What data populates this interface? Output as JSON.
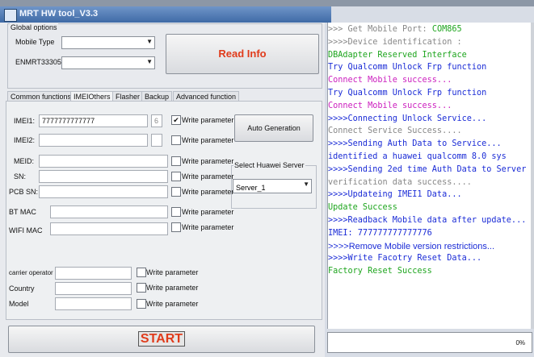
{
  "window": {
    "title": "MRT HW tool_V3.3"
  },
  "global_options": {
    "group_label": "Global options",
    "mobile_type_label": "Mobile Type",
    "mobile_type_value": "",
    "enmrt_label": "ENMRT33305",
    "enmrt_value": "",
    "read_info_label": "Read Info"
  },
  "tabs": [
    {
      "label": "Common functions",
      "active": false
    },
    {
      "label": "IMEIOthers",
      "active": true
    },
    {
      "label": "Flasher",
      "active": false
    },
    {
      "label": "Backup",
      "active": false
    },
    {
      "label": "Advanced function",
      "active": false
    }
  ],
  "imei_panel": {
    "imei1_label": "IMEI1:",
    "imei1_value": "7777777777777",
    "imei1_check_digit": "6",
    "imei2_label": "IMEI2:",
    "imei2_value": "",
    "meid_label": "MEID:",
    "sn_label": "SN:",
    "pcb_sn_label": "PCB SN:",
    "bt_mac_label": "BT MAC",
    "wifi_mac_label": "WIFI MAC",
    "carrier_label": "carrier operator",
    "country_label": "Country",
    "model_label": "Model",
    "write_param_label": "Write parameter",
    "write_imei1_checked": true,
    "auto_generation_label": "Auto Generation",
    "server_group_label": "Select Huawei Server",
    "server_value": "Server_1"
  },
  "start_label": "START",
  "progress": {
    "percent_text": "0%",
    "value": 0
  },
  "colors": {
    "prompt": "#7d8fa6",
    "blue": "#1a2bd6",
    "green": "#1ea51e",
    "magenta": "#cc1fbf",
    "gray": "#888888",
    "accent": "#e03b1b"
  },
  "log": [
    {
      "text": ">>> Get Mobile Port:  COM865",
      "color": "gray",
      "highlight": "COM865",
      "highlight_color": "green"
    },
    {
      "text": ">>>>Device identification :",
      "color": "gray"
    },
    {
      "text": "    DBAdapter Reserved Interface",
      "color": "green"
    },
    {
      "text": "    Try Qualcomm Unlock Frp function",
      "color": "blue"
    },
    {
      "text": "    Connect Mobile success...",
      "color": "magenta"
    },
    {
      "text": "    Try Qualcomm Unlock Frp function",
      "color": "blue"
    },
    {
      "text": "    Connect Mobile success...",
      "color": "magenta"
    },
    {
      "text": ">>>>Connecting Unlock Service...",
      "color": "blue"
    },
    {
      "text": "    Connect Service Success....",
      "color": "gray"
    },
    {
      "text": ">>>>Sending Auth Data to Service...",
      "color": "blue"
    },
    {
      "text": "    identified a huawei qualcomm 8.0 sys",
      "color": "blue"
    },
    {
      "text": ">>>>Sending 2ed time Auth Data to Server",
      "color": "blue"
    },
    {
      "text": "    verification data success....",
      "color": "gray"
    },
    {
      "text": ">>>>Updateing IMEI1 Data...",
      "color": "blue"
    },
    {
      "text": "    Update Success",
      "color": "green"
    },
    {
      "text": ">>>>Readback Mobile data after update...",
      "color": "blue"
    },
    {
      "text": "    IMEI: 777777777777776",
      "color": "blue"
    },
    {
      "text": ">>>>Remove Mobile version restrictions...",
      "color": "blue",
      "proportional": true
    },
    {
      "text": ">>>>Write Facotry Reset Data...",
      "color": "blue"
    },
    {
      "text": "    Factory Reset Success",
      "color": "green"
    }
  ]
}
